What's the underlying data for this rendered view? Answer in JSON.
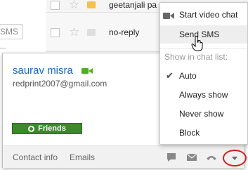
{
  "background": {
    "search_field": {
      "value": "SMS"
    },
    "messages": [
      {
        "sender": "geetanjali pa"
      },
      {
        "sender": "no-reply"
      }
    ]
  },
  "contact_card": {
    "name": "saurav misra",
    "email": "redprint2007@gmail.com",
    "group_button": "Friends",
    "footer": {
      "contact_info": "Contact info",
      "emails": "Emails"
    },
    "icons": [
      "video-icon",
      "chat-icon",
      "mail-icon",
      "phone-icon",
      "dropdown-arrow-icon"
    ]
  },
  "menu": {
    "items": [
      {
        "label": "Start video chat",
        "icon": "video-icon"
      },
      {
        "label": "Send SMS",
        "hovered": true
      }
    ],
    "chat_list_header": "Show in chat list:",
    "chat_list_options": [
      {
        "label": "Auto",
        "checked": true
      },
      {
        "label": "Always show",
        "checked": false
      },
      {
        "label": "Never show",
        "checked": false
      },
      {
        "label": "Block",
        "checked": false
      }
    ]
  },
  "colors": {
    "name_link": "#1a63c4",
    "friends_button": "#3a8a2a",
    "highlight_circle": "#d21f1f",
    "video_icon": "#4caf24"
  }
}
